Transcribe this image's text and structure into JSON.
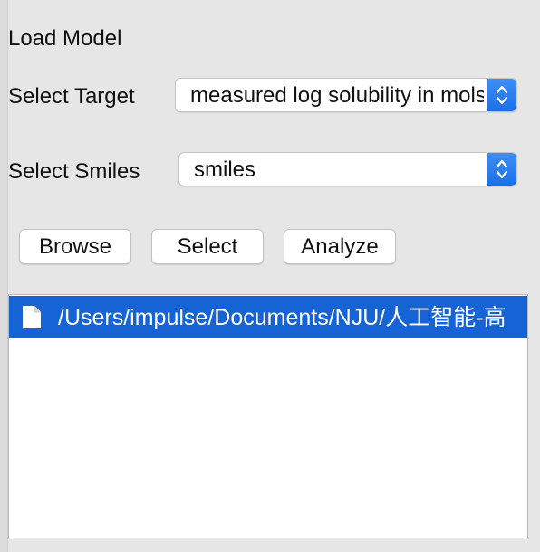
{
  "panel": {
    "heading": "Load Model",
    "target": {
      "label": "Select Target",
      "value": "measured log solubility in mols per litre"
    },
    "smiles": {
      "label": "Select Smiles",
      "value": "smiles"
    },
    "buttons": {
      "browse": "Browse",
      "select": "Select",
      "analyze": "Analyze"
    }
  },
  "file_list": {
    "items": [
      {
        "path": "/Users/impulse/Documents/NJU/人工智能-高",
        "selected": true,
        "icon": "document-icon"
      }
    ]
  },
  "colors": {
    "background": "#e6e6e6",
    "accent": "#1663d6",
    "stepper": "#2a7ef0"
  }
}
